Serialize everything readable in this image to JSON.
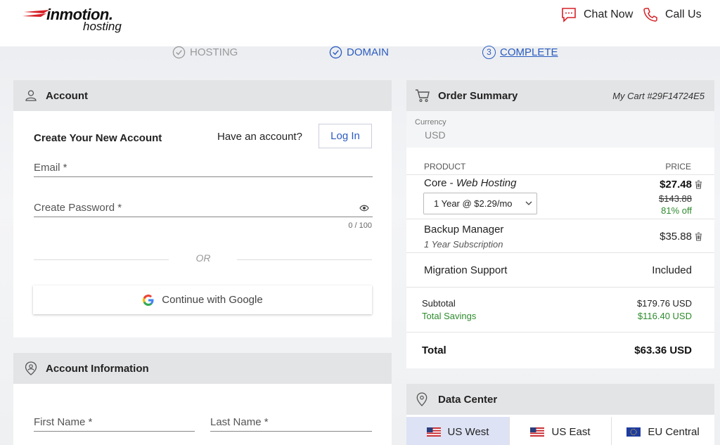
{
  "brand": {
    "name": "inmotion.",
    "sub": "hosting"
  },
  "header": {
    "chat_label": "Chat Now",
    "call_label": "Call Us"
  },
  "steps": [
    {
      "label": "HOSTING",
      "state": "done"
    },
    {
      "label": "DOMAIN",
      "state": "done"
    },
    {
      "number": "3",
      "label": "COMPLETE",
      "state": "current"
    }
  ],
  "account": {
    "title": "Account",
    "create_title": "Create Your New Account",
    "have_account": "Have an account?",
    "login_label": "Log In",
    "email_label": "Email *",
    "password_label": "Create Password *",
    "password_counter": "0 / 100",
    "or_label": "OR",
    "google_label": "Continue with Google"
  },
  "account_info": {
    "title": "Account Information",
    "first_name_label": "First Name *",
    "last_name_label": "Last Name *"
  },
  "order": {
    "title": "Order Summary",
    "cart_id": "My Cart #29F14724E5",
    "currency_label": "Currency",
    "currency_value": "USD",
    "col_product": "PRODUCT",
    "col_price": "PRICE",
    "items": [
      {
        "name": "Core",
        "sep": " - ",
        "type": "Web Hosting",
        "price": "$27.48",
        "old_price": "$143.88",
        "discount": "81% off",
        "term": "1 Year @ $2.29/mo"
      },
      {
        "name": "Backup Manager",
        "sub": "1 Year Subscription",
        "price": "$35.88"
      },
      {
        "name": "Migration Support",
        "price": "Included"
      }
    ],
    "subtotal_label": "Subtotal",
    "subtotal_value": "$179.76 USD",
    "savings_label": "Total Savings",
    "savings_value": "$116.40 USD",
    "total_label": "Total",
    "total_value": "$63.36 USD"
  },
  "data_center": {
    "title": "Data Center",
    "tabs": [
      {
        "label": "US West",
        "selected": true
      },
      {
        "label": "US East",
        "selected": false
      },
      {
        "label": "EU Central",
        "selected": false
      }
    ]
  },
  "colors": {
    "brand_red": "#d62027",
    "link_blue": "#2a5bbf",
    "green": "#2e8b2e",
    "selected_tab": "#dde3f5"
  }
}
